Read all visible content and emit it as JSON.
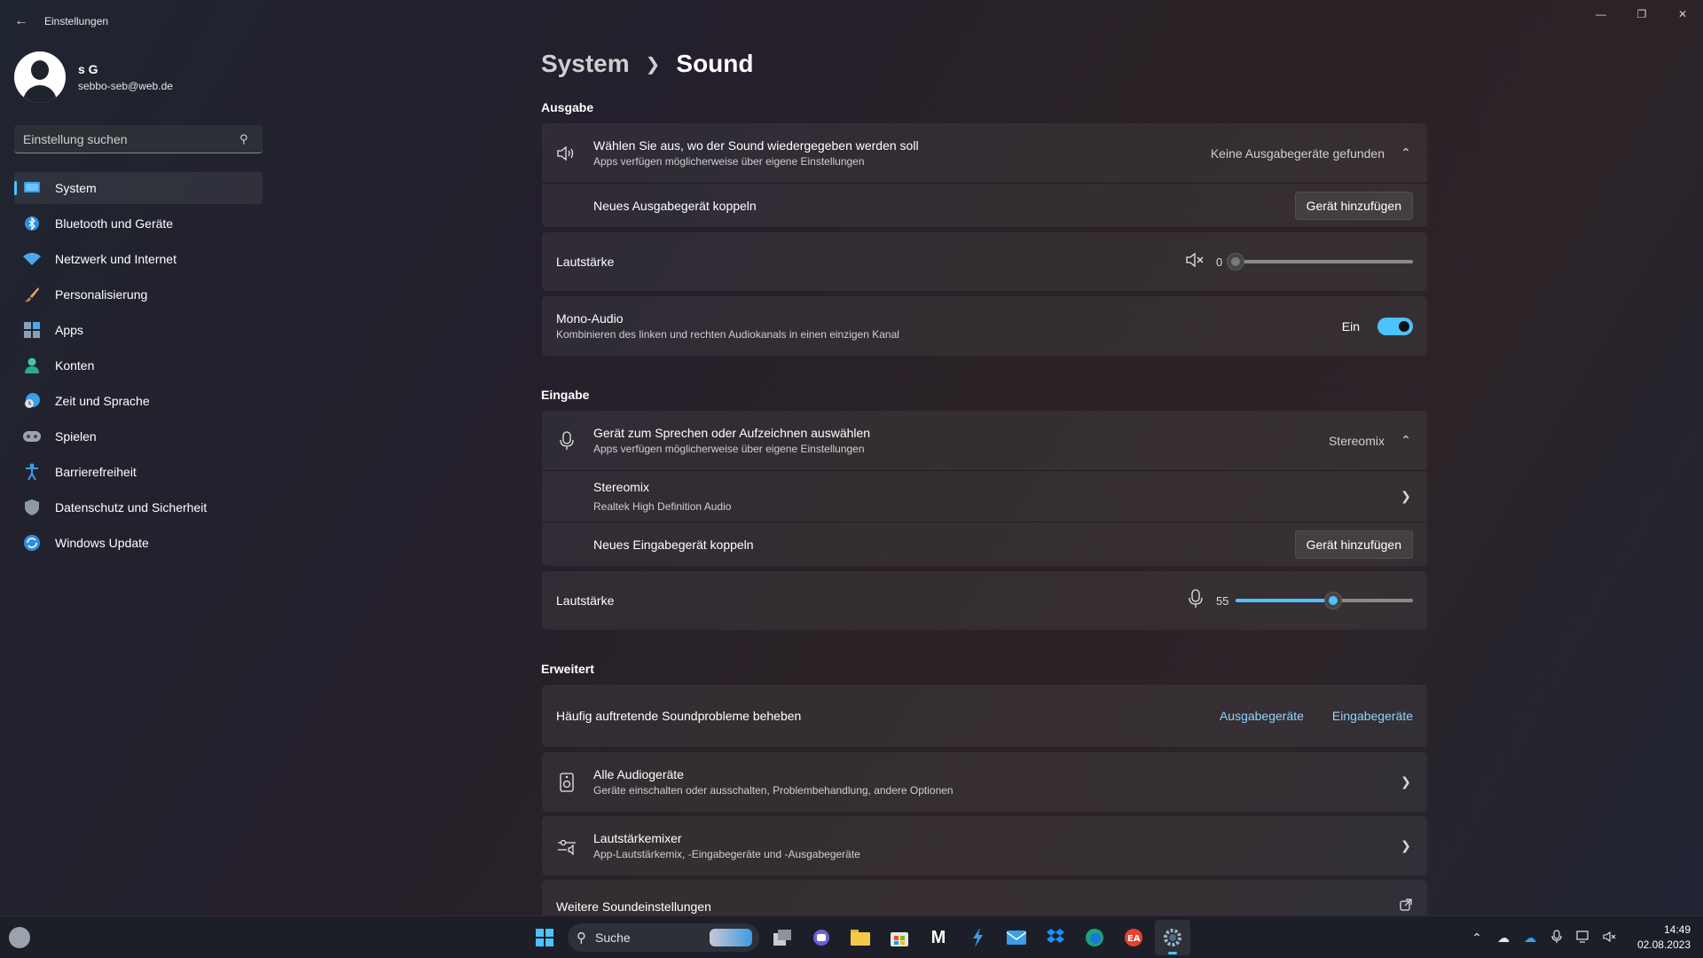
{
  "window": {
    "title": "Einstellungen"
  },
  "profile": {
    "name": "s G",
    "email": "sebbo-seb@web.de"
  },
  "search": {
    "placeholder": "Einstellung suchen"
  },
  "sidebar": {
    "items": [
      {
        "label": "System",
        "icon": "monitor-icon",
        "active": true
      },
      {
        "label": "Bluetooth und Geräte",
        "icon": "bluetooth-icon"
      },
      {
        "label": "Netzwerk und Internet",
        "icon": "wifi-icon"
      },
      {
        "label": "Personalisierung",
        "icon": "brush-icon"
      },
      {
        "label": "Apps",
        "icon": "apps-icon"
      },
      {
        "label": "Konten",
        "icon": "person-icon"
      },
      {
        "label": "Zeit und Sprache",
        "icon": "globe-clock-icon"
      },
      {
        "label": "Spielen",
        "icon": "gamepad-icon"
      },
      {
        "label": "Barrierefreiheit",
        "icon": "accessibility-icon"
      },
      {
        "label": "Datenschutz und Sicherheit",
        "icon": "shield-icon"
      },
      {
        "label": "Windows Update",
        "icon": "update-icon"
      }
    ]
  },
  "breadcrumb": {
    "parent": "System",
    "current": "Sound"
  },
  "output": {
    "section_title": "Ausgabe",
    "select_title": "Wählen Sie aus, wo der Sound wiedergegeben werden soll",
    "select_sub": "Apps verfügen möglicherweise über eigene Einstellungen",
    "select_value": "Keine Ausgabegeräte gefunden",
    "pair_label": "Neues Ausgabegerät koppeln",
    "pair_button": "Gerät hinzufügen",
    "volume_label": "Lautstärke",
    "volume_value": "0",
    "volume_fraction": 0.0,
    "mono_title": "Mono-Audio",
    "mono_sub": "Kombinieren des linken und rechten Audiokanals in einen einzigen Kanal",
    "mono_state": "Ein"
  },
  "input": {
    "section_title": "Eingabe",
    "select_title": "Gerät zum Sprechen oder Aufzeichnen auswählen",
    "select_sub": "Apps verfügen möglicherweise über eigene Einstellungen",
    "select_value": "Stereomix",
    "device_name": "Stereomix",
    "device_sub": "Realtek High Definition Audio",
    "pair_label": "Neues Eingabegerät koppeln",
    "pair_button": "Gerät hinzufügen",
    "volume_label": "Lautstärke",
    "volume_value": "55",
    "volume_fraction": 0.55
  },
  "advanced": {
    "section_title": "Erweitert",
    "troubleshoot_label": "Häufig auftretende Soundprobleme beheben",
    "link_output": "Ausgabegeräte",
    "link_input": "Eingabegeräte",
    "all_devices_title": "Alle Audiogeräte",
    "all_devices_sub": "Geräte einschalten oder ausschalten, Problembehandlung, andere Optionen",
    "mixer_title": "Lautstärkemixer",
    "mixer_sub": "App-Lautstärkemix, -Eingabegeräte und -Ausgabegeräte",
    "more_label": "Weitere Soundeinstellungen"
  },
  "taskbar": {
    "search_label": "Suche",
    "time": "14:49",
    "date": "02.08.2023"
  },
  "colors": {
    "accent": "#4cc2ff",
    "link": "#8fd4ff"
  }
}
